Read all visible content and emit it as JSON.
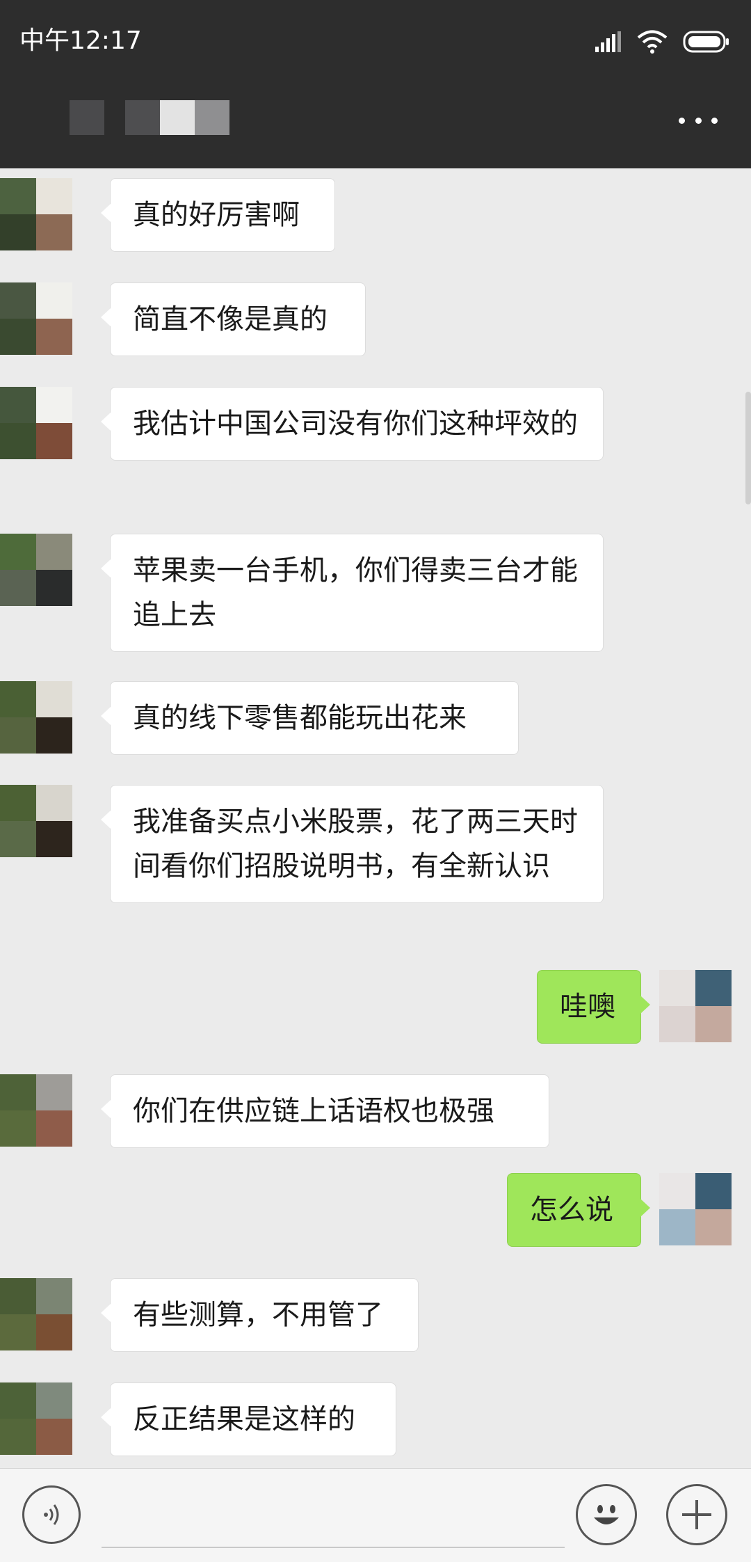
{
  "status_bar": {
    "time": "中午12:17"
  },
  "header": {
    "more_label": "..."
  },
  "messages": [
    {
      "side": "left",
      "text": "真的好厉害啊"
    },
    {
      "side": "left",
      "text": "简直不像是真的"
    },
    {
      "side": "left",
      "text": "我估计中国公司没有你们这种坪效的"
    },
    {
      "side": "left",
      "text": "苹果卖一台手机，你们得卖三台才能追上去"
    },
    {
      "side": "left",
      "text": "真的线下零售都能玩出花来"
    },
    {
      "side": "left",
      "text": "我准备买点小米股票，花了两三天时间看你们招股说明书，有全新认识"
    },
    {
      "side": "right",
      "text": "哇噢"
    },
    {
      "side": "left",
      "text": "你们在供应链上话语权也极强"
    },
    {
      "side": "right",
      "text": "怎么说"
    },
    {
      "side": "left",
      "text": "有些测算，不用管了"
    },
    {
      "side": "left",
      "text": "反正结果是这样的"
    }
  ],
  "input_bar": {
    "placeholder": ""
  },
  "icons": {
    "voice": "voice-icon",
    "emoji": "emoji-icon",
    "plus": "plus-icon",
    "more": "more-icon",
    "signal": "signal-icon",
    "wifi": "wifi-icon",
    "battery": "battery-icon"
  },
  "colors": {
    "bar_bg": "#2d2d2d",
    "chat_bg": "#ebebeb",
    "sent_bubble": "#9fe65a",
    "received_bubble": "#ffffff"
  }
}
